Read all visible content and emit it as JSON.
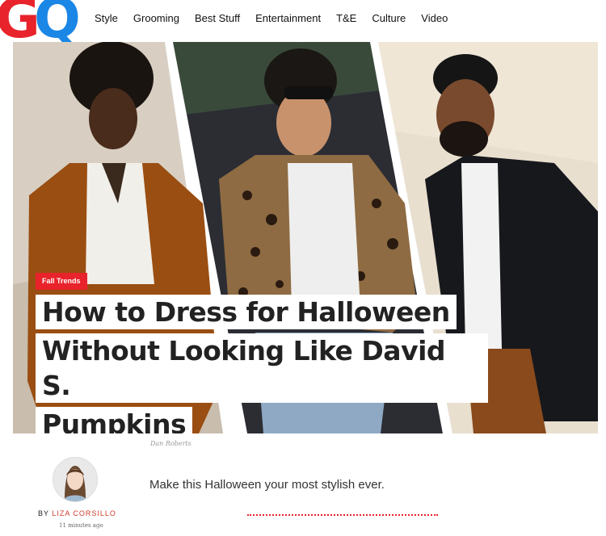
{
  "brand": {
    "logo_text_g": "G",
    "logo_text_q": "Q",
    "colors": {
      "red": "#e8232b",
      "blue": "#1a86e6"
    }
  },
  "nav": {
    "items": [
      "Style",
      "Grooming",
      "Best Stuff",
      "Entertainment",
      "T&E",
      "Culture",
      "Video"
    ]
  },
  "hero": {
    "tag": "Fall Trends",
    "headline_lines": [
      "How to Dress for Halloween",
      "Without Looking Like David S.",
      "Pumpkins"
    ],
    "photo_credit": "Dan Roberts"
  },
  "article": {
    "dek": "Make this Halloween your most stylish ever.",
    "byline_prefix": "BY",
    "author": "LIZA CORSILLO",
    "time": "11 minutes ago"
  }
}
